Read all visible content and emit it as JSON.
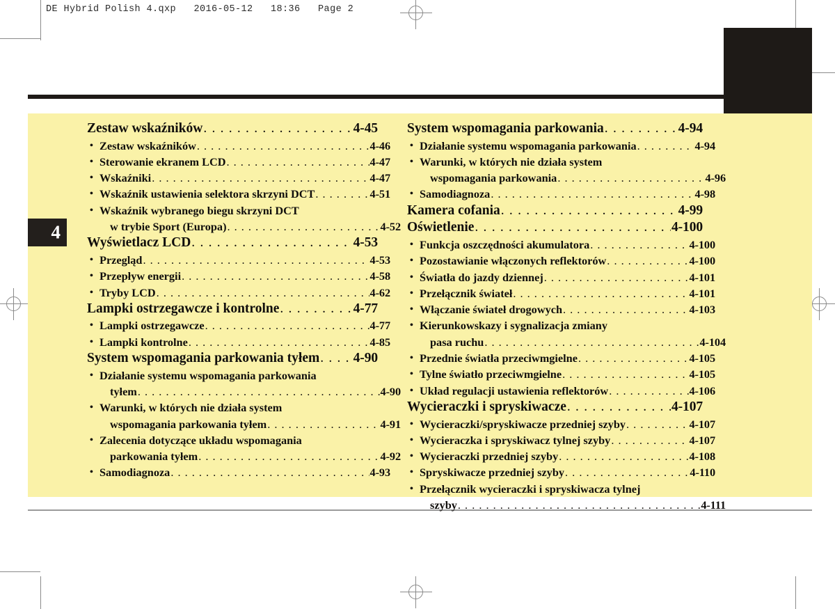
{
  "print_header": "DE Hybrid Polish 4.qxp   2016-05-12   18:36   Page 2",
  "chapter": {
    "number": "4"
  },
  "toc": {
    "left_column": [
      {
        "level": 1,
        "label": "Zestaw wskaźników",
        "page": "4-45",
        "leader": true
      },
      {
        "level": 2,
        "label": "Zestaw wskaźników",
        "page": "4-46",
        "leader": true
      },
      {
        "level": 2,
        "label": "Sterowanie ekranem LCD",
        "page": "4-47",
        "leader": true
      },
      {
        "level": 2,
        "label": "Wskaźniki",
        "page": "4-47",
        "leader": true
      },
      {
        "level": 2,
        "label": "Wskaźnik ustawienia selektora skrzyni DCT",
        "page": "4-51",
        "leader": true
      },
      {
        "level": 2,
        "label": "Wskaźnik wybranego biegu skrzyni DCT",
        "page": "",
        "leader": false
      },
      {
        "level": "2c",
        "label": "w trybie Sport (Europa)",
        "page": "4-52",
        "leader": true
      },
      {
        "level": 1,
        "label": "Wyświetlacz LCD",
        "page": "4-53",
        "leader": true
      },
      {
        "level": 2,
        "label": "Przegląd",
        "page": "4-53",
        "leader": true
      },
      {
        "level": 2,
        "label": "Przepływ energii",
        "page": "4-58",
        "leader": true
      },
      {
        "level": 2,
        "label": "Tryby LCD",
        "page": "4-62",
        "leader": true
      },
      {
        "level": 1,
        "label": "Lampki ostrzegawcze i kontrolne",
        "page": "4-77",
        "leader": true
      },
      {
        "level": 2,
        "label": "Lampki ostrzegawcze",
        "page": "4-77",
        "leader": true
      },
      {
        "level": 2,
        "label": "Lampki kontrolne",
        "page": "4-85",
        "leader": true
      },
      {
        "level": 1,
        "label": "System wspomagania parkowania tyłem",
        "page": "4-90",
        "leader": true
      },
      {
        "level": 2,
        "label": "Działanie systemu wspomagania parkowania",
        "page": "",
        "leader": false
      },
      {
        "level": "2c",
        "label": "tyłem",
        "page": "4-90",
        "leader": true
      },
      {
        "level": 2,
        "label": "Warunki, w których nie działa system",
        "page": "",
        "leader": false
      },
      {
        "level": "2c",
        "label": "wspomagania parkowania tyłem",
        "page": "4-91",
        "leader": true
      },
      {
        "level": 2,
        "label": "Zalecenia dotyczące układu wspomagania",
        "page": "",
        "leader": false
      },
      {
        "level": "2c",
        "label": "parkowania tyłem",
        "page": "4-92",
        "leader": true
      },
      {
        "level": 2,
        "label": "Samodiagnoza",
        "page": "4-93",
        "leader": true
      }
    ],
    "right_column": [
      {
        "level": 1,
        "label": "System wspomagania parkowania",
        "page": "4-94",
        "leader": true
      },
      {
        "level": 2,
        "label": "Działanie systemu wspomagania parkowania",
        "page": "4-94",
        "leader": true
      },
      {
        "level": 2,
        "label": "Warunki, w których nie działa system",
        "page": "",
        "leader": false
      },
      {
        "level": "2c",
        "label": "wspomagania parkowania",
        "page": "4-96",
        "leader": true
      },
      {
        "level": 2,
        "label": "Samodiagnoza",
        "page": "4-98",
        "leader": true
      },
      {
        "level": 1,
        "label": "Kamera cofania",
        "page": "4-99",
        "leader": true
      },
      {
        "level": 1,
        "label": "Oświetlenie",
        "page": "4-100",
        "leader": true
      },
      {
        "level": 2,
        "label": "Funkcja oszczędności akumulatora",
        "page": "4-100",
        "leader": true
      },
      {
        "level": 2,
        "label": "Pozostawianie włączonych reflektorów",
        "page": "4-100",
        "leader": true
      },
      {
        "level": 2,
        "label": "Światła do jazdy dziennej",
        "page": "4-101",
        "leader": true
      },
      {
        "level": 2,
        "label": "Przełącznik świateł",
        "page": "4-101",
        "leader": true
      },
      {
        "level": 2,
        "label": "Włączanie świateł drogowych",
        "page": "4-103",
        "leader": true
      },
      {
        "level": 2,
        "label": "Kierunkowskazy i sygnalizacja zmiany",
        "page": "",
        "leader": false
      },
      {
        "level": "2c",
        "label": "pasa ruchu",
        "page": "4-104",
        "leader": true
      },
      {
        "level": 2,
        "label": "Przednie światła przeciwmgielne",
        "page": "4-105",
        "leader": true
      },
      {
        "level": 2,
        "label": "Tylne światło przeciwmgielne",
        "page": "4-105",
        "leader": true
      },
      {
        "level": 2,
        "label": "Układ regulacji ustawienia reflektorów",
        "page": "4-106",
        "leader": true
      },
      {
        "level": 1,
        "label": "Wycieraczki i spryskiwacze",
        "page": "4-107",
        "leader": true
      },
      {
        "level": 2,
        "label": "Wycieraczki/spryskiwacze przedniej szyby",
        "page": "4-107",
        "leader": true
      },
      {
        "level": 2,
        "label": "Wycieraczka i spryskiwacz tylnej szyby",
        "page": "4-107",
        "leader": true
      },
      {
        "level": 2,
        "label": "Wycieraczki przedniej szyby",
        "page": "4-108",
        "leader": true
      },
      {
        "level": 2,
        "label": "Spryskiwacze przedniej szyby",
        "page": "4-110",
        "leader": true
      },
      {
        "level": 2,
        "label": "Przełącznik wycieraczki i spryskiwacza tylnej",
        "page": "",
        "leader": false
      },
      {
        "level": "2c",
        "label": "szyby",
        "page": "4-111",
        "leader": true
      }
    ]
  },
  "symbols": {
    "bullet": "•",
    "leader_dot": "."
  },
  "colors": {
    "panel_background": "#faf2a8",
    "ink": "#100e0c",
    "tab_black": "#1e1a17",
    "page_white": "#ffffff",
    "mark_gray": "#8a8a8a"
  }
}
